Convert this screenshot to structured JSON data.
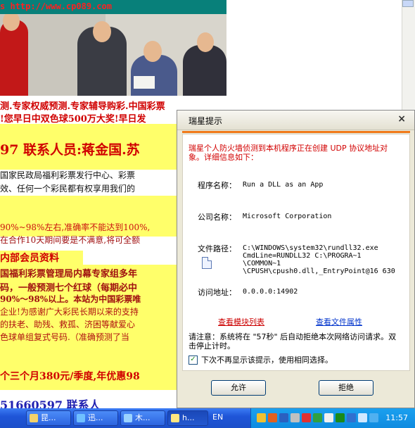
{
  "webpage": {
    "url_text": "s http://www.cp089.com",
    "line1": "测.专家权威预测.专家辅导购彩.中国彩票",
    "line2": "!您早日中双色球500万大奖!早日发",
    "line3": "97 联系人员:蒋金国.苏",
    "line4": "国家民政局福利彩票发行中心、彩票",
    "line5": "效、任何一个彩民都有权享用我们的",
    "line6": "90%~98%左右,准确率不能达到100%,",
    "line7": "在合作10天期间要是不满意,将可全额",
    "line8": "内部会员资料",
    "line9": "国福利彩票管理局内幕专家组多年",
    "line10": "码，一般预测七个红球（每期必中",
    "line11": "90%～98%以上。本站为中国彩票唯",
    "line12": "企业!为感谢广大彩民长期以来的支持",
    "line13": "的扶老、助残、救孤、济困等献爱心",
    "line14": "色球单组复式号码.（准确预测了当",
    "line15": "个三个月380元/季度,年优惠98",
    "line16": "51660597 联系人",
    "colors": {
      "url_bg": "#08807a",
      "highlight": "#ffff6a",
      "red": "#d00000"
    }
  },
  "dialog": {
    "title": "瑞星提示",
    "close_glyph": "×",
    "warning": "瑞星个人防火墙侦测到本机程序正在创建 UDP 协议地址对象。详细信息如下：",
    "program_label": "程序名称：",
    "program_value": "Run a DLL as an App",
    "company_label": "公司名称：",
    "company_value": "Microsoft Corporation",
    "path_label": "文件路径：",
    "path_lines": [
      "C:\\WINDOWS\\system32\\rundll32.exe",
      "CmdLine=RUNDLL32 C:\\PROGRA~1",
      "\\COMMON~1",
      "\\CPUSH\\cpush0.dll,_EntryPoint@16 630"
    ],
    "address_label": "访问地址：",
    "address_value": "0.0.0.0:14902",
    "link_modules": "查看模块列表",
    "link_props": "查看文件属性",
    "note": "请注意：系统将在 \"57秒\" 后自动拒绝本次网络访问请求。双击停止计时。",
    "checkbox_label": "下次不再显示该提示，使用相同选择。",
    "checkbox_checked": true,
    "allow_button": "允许",
    "deny_button": "拒绝",
    "colors": {
      "accent": "#f07a1a",
      "warning": "#d20000",
      "link": "#0033cc"
    }
  },
  "taskbar": {
    "tasks": [
      "昆...",
      "迅...",
      "木...",
      "h..."
    ],
    "language": "EN",
    "clock": "11:57"
  }
}
